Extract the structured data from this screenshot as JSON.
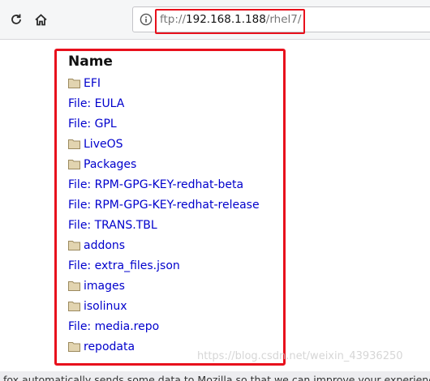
{
  "toolbar": {
    "url": {
      "scheme": "ftp://",
      "host": "192.168.1.188",
      "path": "/rhel7/"
    }
  },
  "listing": {
    "heading": "Name",
    "items": [
      {
        "type": "folder",
        "label": "EFI"
      },
      {
        "type": "file",
        "label": "File: EULA"
      },
      {
        "type": "file",
        "label": "File: GPL"
      },
      {
        "type": "folder",
        "label": "LiveOS"
      },
      {
        "type": "folder",
        "label": "Packages"
      },
      {
        "type": "file",
        "label": "File: RPM-GPG-KEY-redhat-beta"
      },
      {
        "type": "file",
        "label": "File: RPM-GPG-KEY-redhat-release"
      },
      {
        "type": "file",
        "label": "File: TRANS.TBL"
      },
      {
        "type": "folder",
        "label": "addons"
      },
      {
        "type": "file",
        "label": "File: extra_files.json"
      },
      {
        "type": "folder",
        "label": "images"
      },
      {
        "type": "folder",
        "label": "isolinux"
      },
      {
        "type": "file",
        "label": "File: media.repo"
      },
      {
        "type": "folder",
        "label": "repodata"
      }
    ]
  },
  "notification": {
    "text": "fox automatically sends some data to Mozilla so that we can improve your experience"
  },
  "watermark": "https://blog.csdn.net/weixin_43936250",
  "colors": {
    "highlight": "#e8101c",
    "link": "#0000cc"
  },
  "icons": {
    "reload": "reload-icon",
    "home": "home-icon",
    "info": "info-icon",
    "folder": "folder-icon"
  }
}
